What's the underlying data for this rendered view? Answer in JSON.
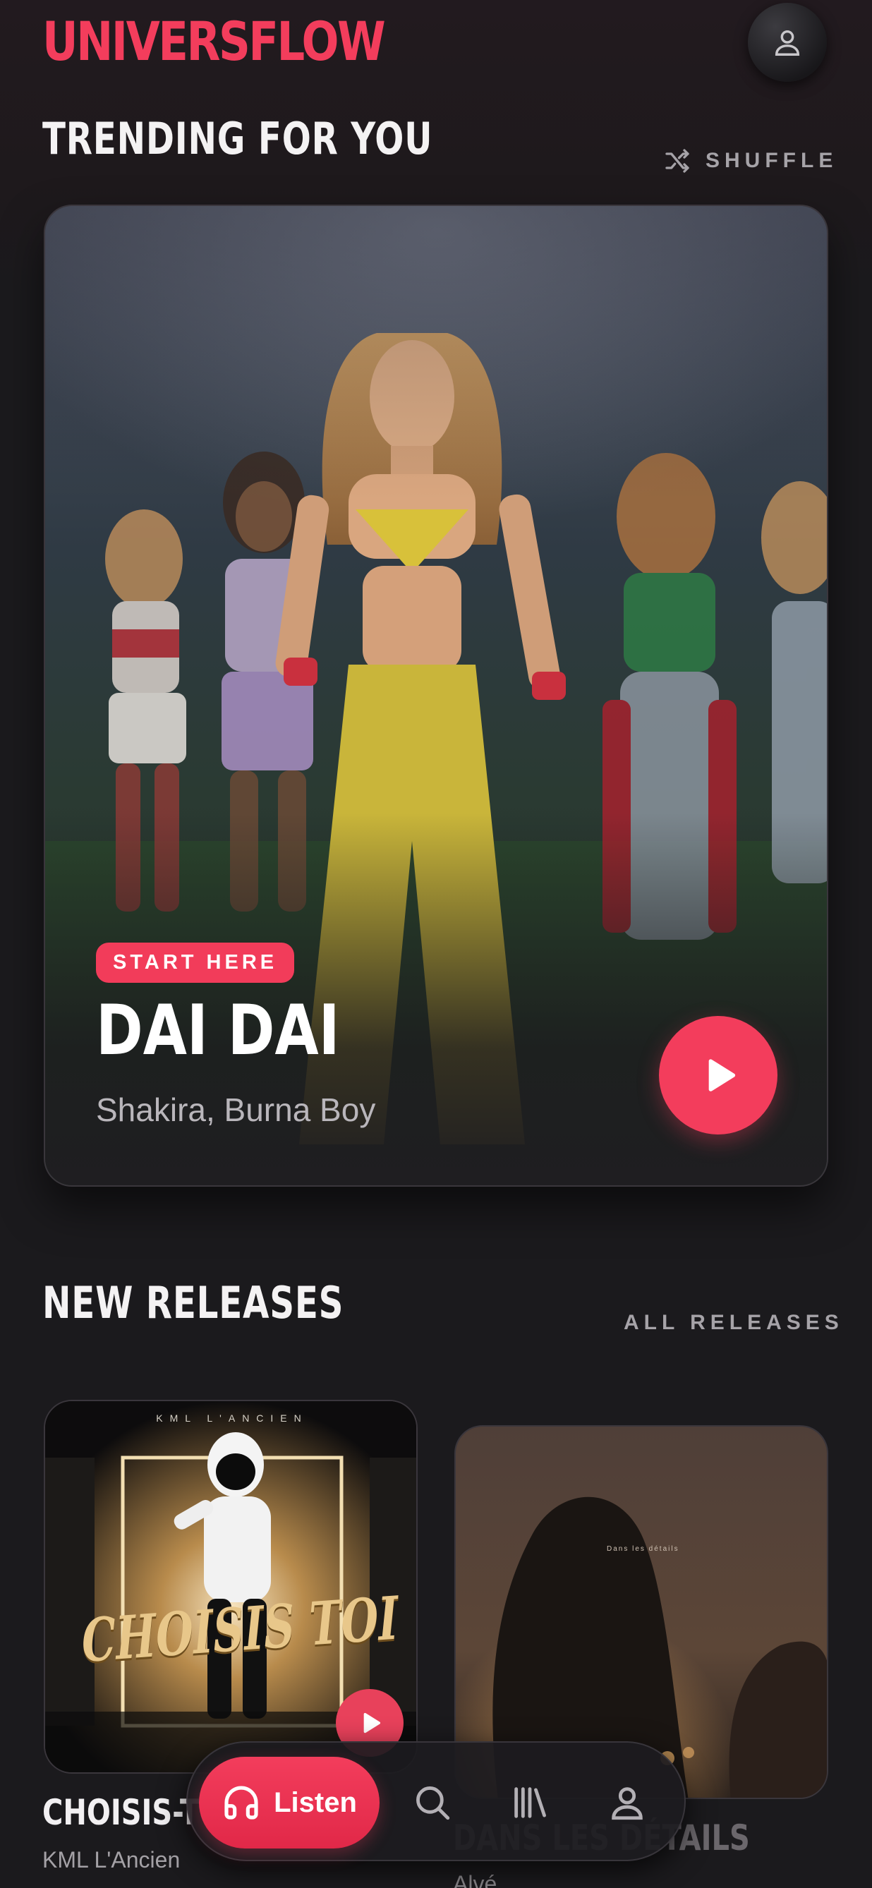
{
  "app": {
    "brand": "UNIVERSFLOW"
  },
  "trending": {
    "title": "TRENDING FOR YOU",
    "shuffle_label": "SHUFFLE",
    "hero": {
      "badge": "START HERE",
      "track_title": "DAI DAI",
      "artists": "Shakira, Burna Boy"
    }
  },
  "new_releases": {
    "title": "NEW RELEASES",
    "link_label": "ALL RELEASES",
    "items": [
      {
        "title": "CHOISIS-TOI",
        "visible_title": "CHOISIS-TO",
        "artist": "KML L'Ancien",
        "cover_text": "CHOISIS TOI",
        "cover_top_text": "KML L'ANCIEN"
      },
      {
        "title": "DANS LES DÉTAILS",
        "artist": "Alvé",
        "cover_text": "Dans les détails"
      }
    ]
  },
  "nav": {
    "listen_label": "Listen",
    "items": [
      {
        "icon": "search-icon"
      },
      {
        "icon": "library-icon"
      },
      {
        "icon": "profile-icon"
      }
    ]
  },
  "colors": {
    "accent": "#f33d5c",
    "background": "#1b1a1d",
    "muted_text": "#a6a3a8"
  }
}
